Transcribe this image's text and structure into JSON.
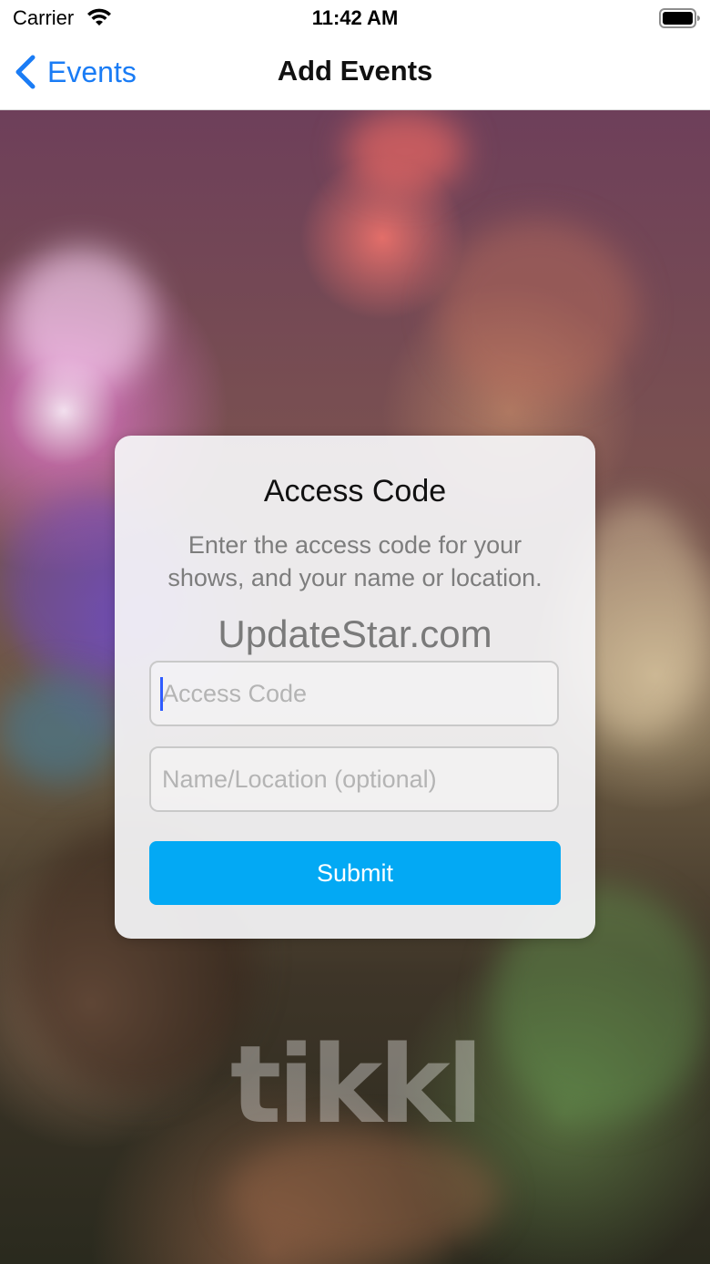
{
  "status_bar": {
    "carrier": "Carrier",
    "time": "11:42 AM",
    "icons": [
      "wifi-icon",
      "battery-icon"
    ]
  },
  "nav": {
    "back_label": "Events",
    "back_icon": "chevron-left-icon",
    "title": "Add Events"
  },
  "dialog": {
    "title": "Access Code",
    "description": "Enter the access code for your shows, and your name or location.",
    "access_code": {
      "value": "",
      "placeholder": "Access Code"
    },
    "name_location": {
      "value": "",
      "placeholder": "Name/Location (optional)"
    },
    "submit_label": "Submit"
  },
  "watermark_overlay": "UpdateStar.com",
  "brand_logo": "tikkl",
  "colors": {
    "accent": "#1a7cf5",
    "submit_button": "#03a9f4",
    "cursor": "#2e5bff"
  }
}
